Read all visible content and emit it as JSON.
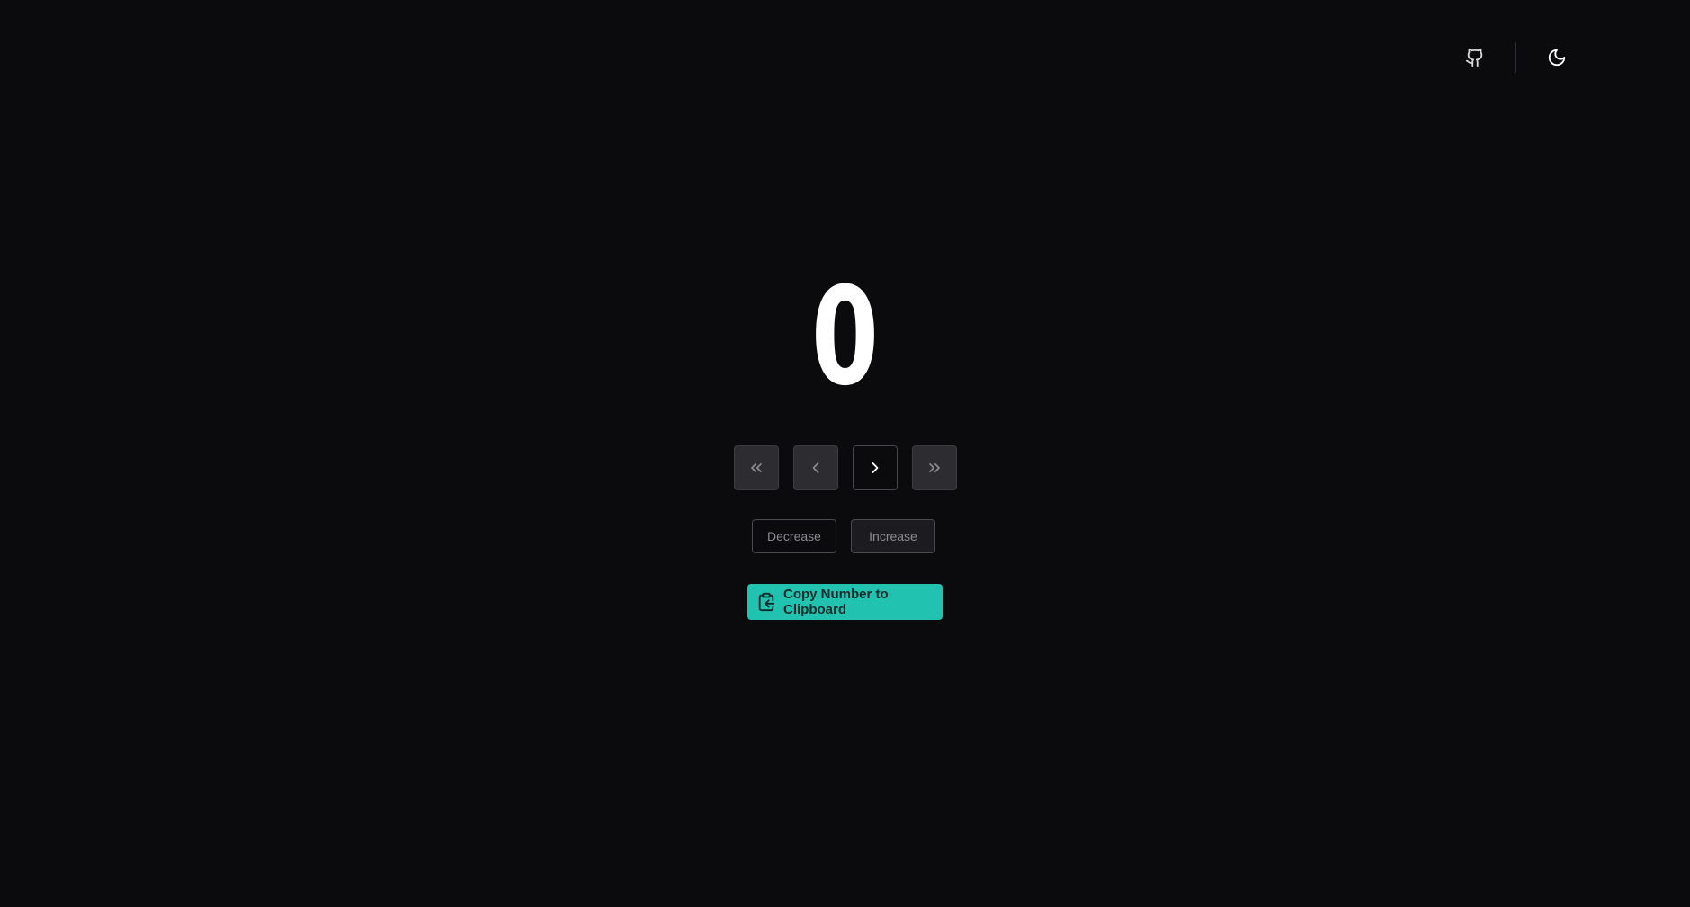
{
  "header": {
    "github_icon": "github-icon",
    "theme_icon": "moon-icon"
  },
  "counter": {
    "value": "0"
  },
  "step_controls": {
    "first_icon": "chevrons-left-icon",
    "prev_icon": "chevron-left-icon",
    "next_icon": "chevron-right-icon",
    "last_icon": "chevrons-right-icon"
  },
  "actions": {
    "decrease_label": "Decrease",
    "increase_label": "Increase"
  },
  "copy": {
    "label": "Copy Number to Clipboard",
    "icon": "clipboard-icon"
  },
  "colors": {
    "background": "#0b0b0e",
    "accent": "#22c2b0"
  }
}
